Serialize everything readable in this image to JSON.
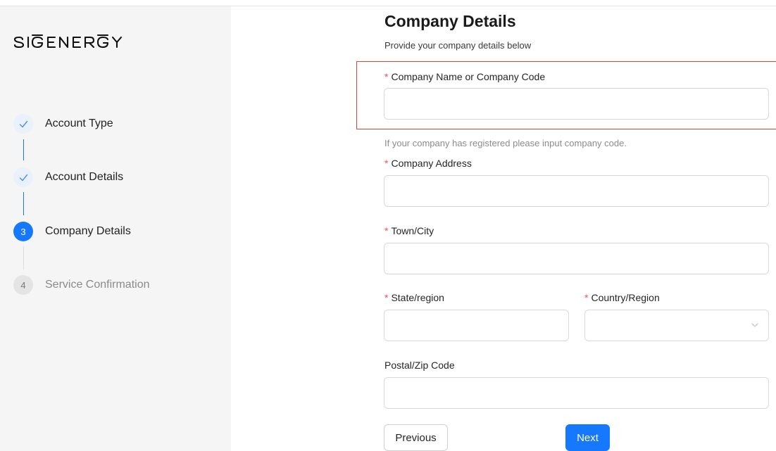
{
  "brand": {
    "logo_text": "SIGENERGY"
  },
  "steps": [
    {
      "number": "1",
      "label": "Account Type",
      "status": "done",
      "icon": "check-icon"
    },
    {
      "number": "2",
      "label": "Account Details",
      "status": "done",
      "icon": "check-icon"
    },
    {
      "number": "3",
      "label": "Company Details",
      "status": "active"
    },
    {
      "number": "4",
      "label": "Service Confirmation",
      "status": "pending"
    }
  ],
  "form": {
    "title": "Company Details",
    "subtitle": "Provide your company details below",
    "required_mark": "*",
    "company_name": {
      "label": "Company Name or Company Code",
      "value": "",
      "required": true
    },
    "help_text": "If your company has registered please input company code.",
    "company_address": {
      "label": "Company Address",
      "value": "",
      "required": true
    },
    "town_city": {
      "label": "Town/City",
      "value": "",
      "required": true
    },
    "state_region": {
      "label": "State/region",
      "value": "",
      "required": true
    },
    "country_region": {
      "label": "Country/Region",
      "value": "",
      "required": true,
      "icon": "chevron-down-icon"
    },
    "postal_code": {
      "label": "Postal/Zip Code",
      "value": "",
      "required": false
    }
  },
  "buttons": {
    "previous": "Previous",
    "next": "Next"
  },
  "colors": {
    "primary": "#1677ff",
    "required": "#ff4d4f",
    "highlight_border": "#d8453a",
    "sidebar_bg": "#f5f5f5"
  }
}
